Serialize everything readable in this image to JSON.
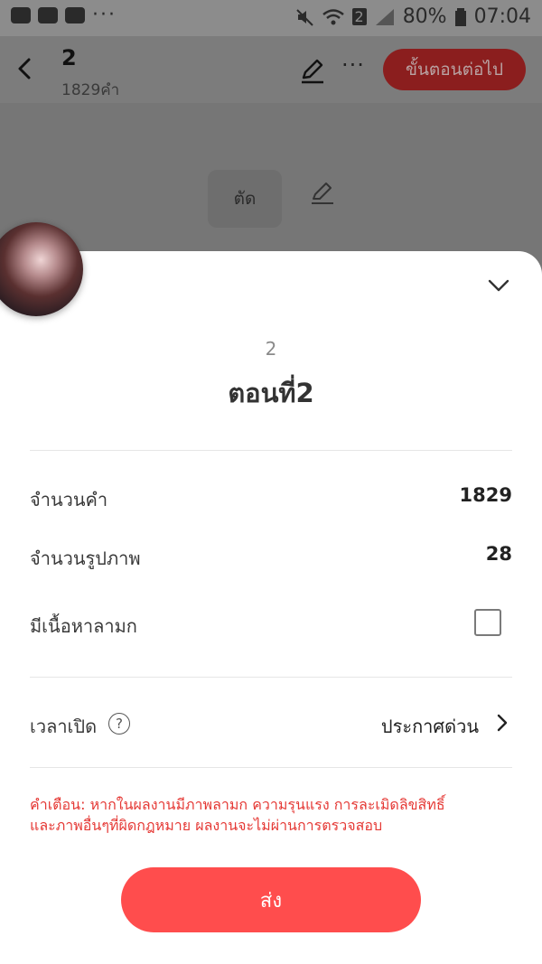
{
  "status_bar": {
    "battery": "80%",
    "time": "07:04",
    "sim_badge": "2",
    "icons": [
      "app-icon",
      "youtube-icon",
      "youtube-icon",
      "more-dots-icon",
      "mute-icon",
      "wifi-icon",
      "signal-icon",
      "battery-icon"
    ]
  },
  "header": {
    "title": "2",
    "word_count_label": "1829คำ",
    "more_label": "···",
    "next_button": "ขั้นตอนต่อไป"
  },
  "background": {
    "cut_button": "ตัด"
  },
  "sheet": {
    "episode_number": "2",
    "episode_title": "ตอนที่2",
    "rows": [
      {
        "label": "จำนวนคำ",
        "value": "1829"
      },
      {
        "label": "จำนวนรูปภาพ",
        "value": "28"
      },
      {
        "label": "มีเนื้อหาลามก",
        "checked": false
      }
    ],
    "publish_time": {
      "label": "เวลาเปิด",
      "help": "?",
      "value": "ประกาศด่วน"
    },
    "warning_line1": "คำเตือน: หากในผลงานมีภาพลามก ความรุนแรง การละเมิดลิขสิทธิ์",
    "warning_line2": "และภาพอื่นๆที่ผิดกฎหมาย ผลงานจะไม่ผ่านการตรวจสอบ",
    "send_button": "ส่ง"
  },
  "colors": {
    "accent": "#ff4d4d",
    "warning": "#e53935",
    "next_button_dimmed": "#8b1e1e"
  }
}
